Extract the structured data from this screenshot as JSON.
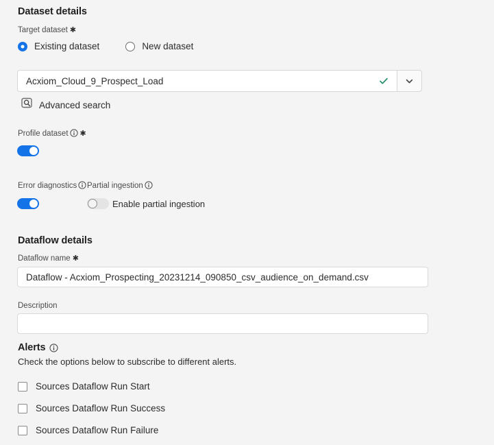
{
  "colors": {
    "background": "#f4f4f4",
    "accent_blue": "#1473e6",
    "check_green": "#268e6c",
    "input_bg": "#ffffff",
    "input_border": "#d9d9d9",
    "text": "#2c2c2c"
  },
  "dataset_details": {
    "heading": "Dataset details",
    "target_dataset_label": "Target dataset",
    "target_dataset_required": "✱",
    "radio_options": [
      {
        "label": "Existing dataset",
        "selected": true
      },
      {
        "label": "New dataset",
        "selected": false
      }
    ],
    "dataset_combobox": {
      "value": "Acxiom_Cloud_9_Prospect_Load",
      "placeholder": "Select dataset",
      "valid_check": "checkmark-icon",
      "dropdown_icon": "chevron-down-icon"
    },
    "advanced_search_label": "Advanced search",
    "advanced_search_icon": "magnifier-box-icon",
    "profile_dataset": {
      "label": "Profile dataset",
      "info_icon": "info-icon",
      "required": "✱",
      "toggle_state": "on"
    },
    "error_diagnostics": {
      "label": "Error diagnostics",
      "info_icon": "info-icon",
      "toggle_state": "on"
    },
    "partial_ingestion": {
      "label": "Partial ingestion",
      "info_icon": "info-icon",
      "toggle_state": "off",
      "toggle_label": "Enable partial ingestion"
    }
  },
  "dataflow_details": {
    "heading": "Dataflow details",
    "name_label": "Dataflow name",
    "name_required": "✱",
    "name_value": "Dataflow - Acxiom_Prospecting_20231214_090850_csv_audience_on_demand.csv",
    "name_placeholder": "Dataflow name",
    "description_label": "Description",
    "description_value": "",
    "description_placeholder": ""
  },
  "alerts": {
    "heading": "Alerts",
    "info_icon": "info-icon",
    "subtitle": "Check the options below to subscribe to different alerts.",
    "options": [
      {
        "label": "Sources Dataflow Run Start",
        "checked": false
      },
      {
        "label": "Sources Dataflow Run Success",
        "checked": false
      },
      {
        "label": "Sources Dataflow Run Failure",
        "checked": false
      }
    ]
  }
}
